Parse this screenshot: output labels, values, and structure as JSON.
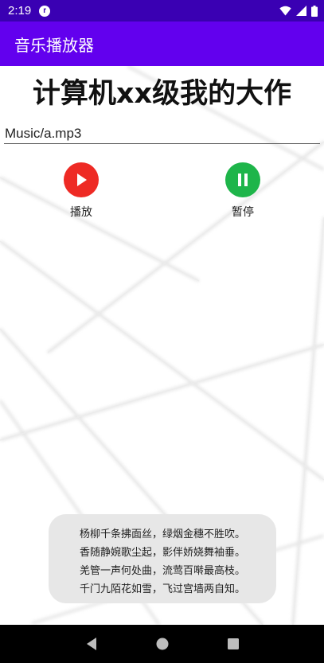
{
  "status_bar": {
    "time": "2:19",
    "notification_icon": "record-icon",
    "wifi_icon": "wifi-icon",
    "signal_icon": "signal-icon",
    "battery_icon": "battery-icon"
  },
  "app_bar": {
    "title": "音乐播放器"
  },
  "main": {
    "headline": "计算机xx级我的大作",
    "file_path": "Music/a.mp3",
    "play_label": "播放",
    "pause_label": "暂停",
    "colors": {
      "play": "#ee2a24",
      "pause": "#1eb54a",
      "accent": "#6200ee"
    }
  },
  "toast": {
    "lines": [
      "杨柳千条拂面丝，绿烟金穗不胜吹。",
      "香随静婉歌尘起，影伴娇娆舞袖垂。",
      "羌管一声何处曲，流莺百啭最高枝。",
      "千门九陌花如雪，飞过宫墙两自知。"
    ]
  },
  "nav_bar": {
    "back_icon": "back-triangle-icon",
    "home_icon": "home-circle-icon",
    "recents_icon": "recents-square-icon"
  }
}
